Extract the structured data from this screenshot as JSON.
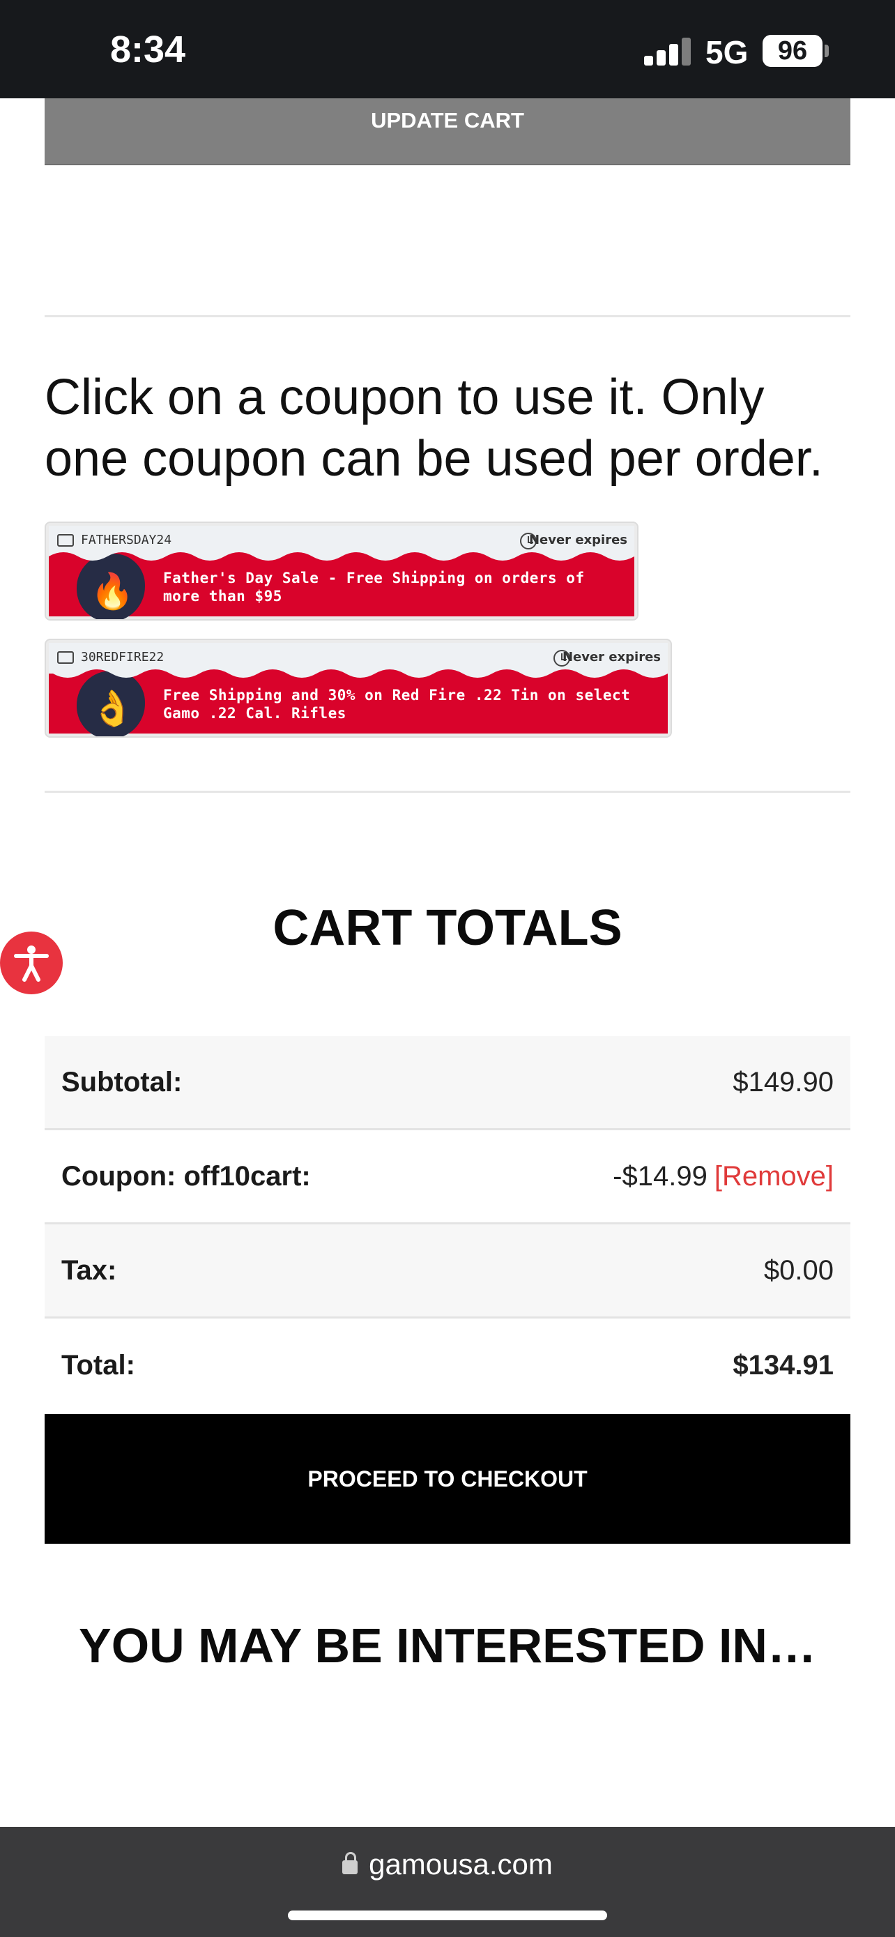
{
  "status_bar": {
    "time": "8:34",
    "network": "5G",
    "battery": "96"
  },
  "buttons": {
    "update_cart": "UPDATE CART",
    "proceed_to_checkout": "PROCEED TO CHECKOUT"
  },
  "coupon_section": {
    "heading": "Click on a coupon to use it. Only one coupon can be used per order.",
    "coupons": [
      {
        "code": "FATHERSDAY24",
        "expiry": "Never expires",
        "description": "Father's Day Sale - Free Shipping on orders of more than $95",
        "icon": "fire-emoji",
        "emoji": "🔥"
      },
      {
        "code": "30REDFIRE22",
        "expiry": "Never expires",
        "description": "Free Shipping and 30% on Red Fire .22 Tin on select Gamo .22 Cal. Rifles",
        "icon": "ok-hand-emoji",
        "emoji": "👌"
      }
    ]
  },
  "cart_totals": {
    "title": "CART TOTALS",
    "rows": [
      {
        "label": "Subtotal:",
        "value": "$149.90"
      },
      {
        "label": "Coupon: off10cart:",
        "value": "-$14.99",
        "action": "[Remove]"
      },
      {
        "label": "Tax:",
        "value": "$0.00"
      },
      {
        "label": "Total:",
        "value": "$134.91"
      }
    ]
  },
  "interested_heading": "YOU MAY BE INTERESTED IN…",
  "browser": {
    "url": "gamousa.com"
  },
  "colors": {
    "coupon_red": "#d9032b",
    "remove_red": "#e03a3a",
    "accessibility_red": "#e8333f"
  }
}
